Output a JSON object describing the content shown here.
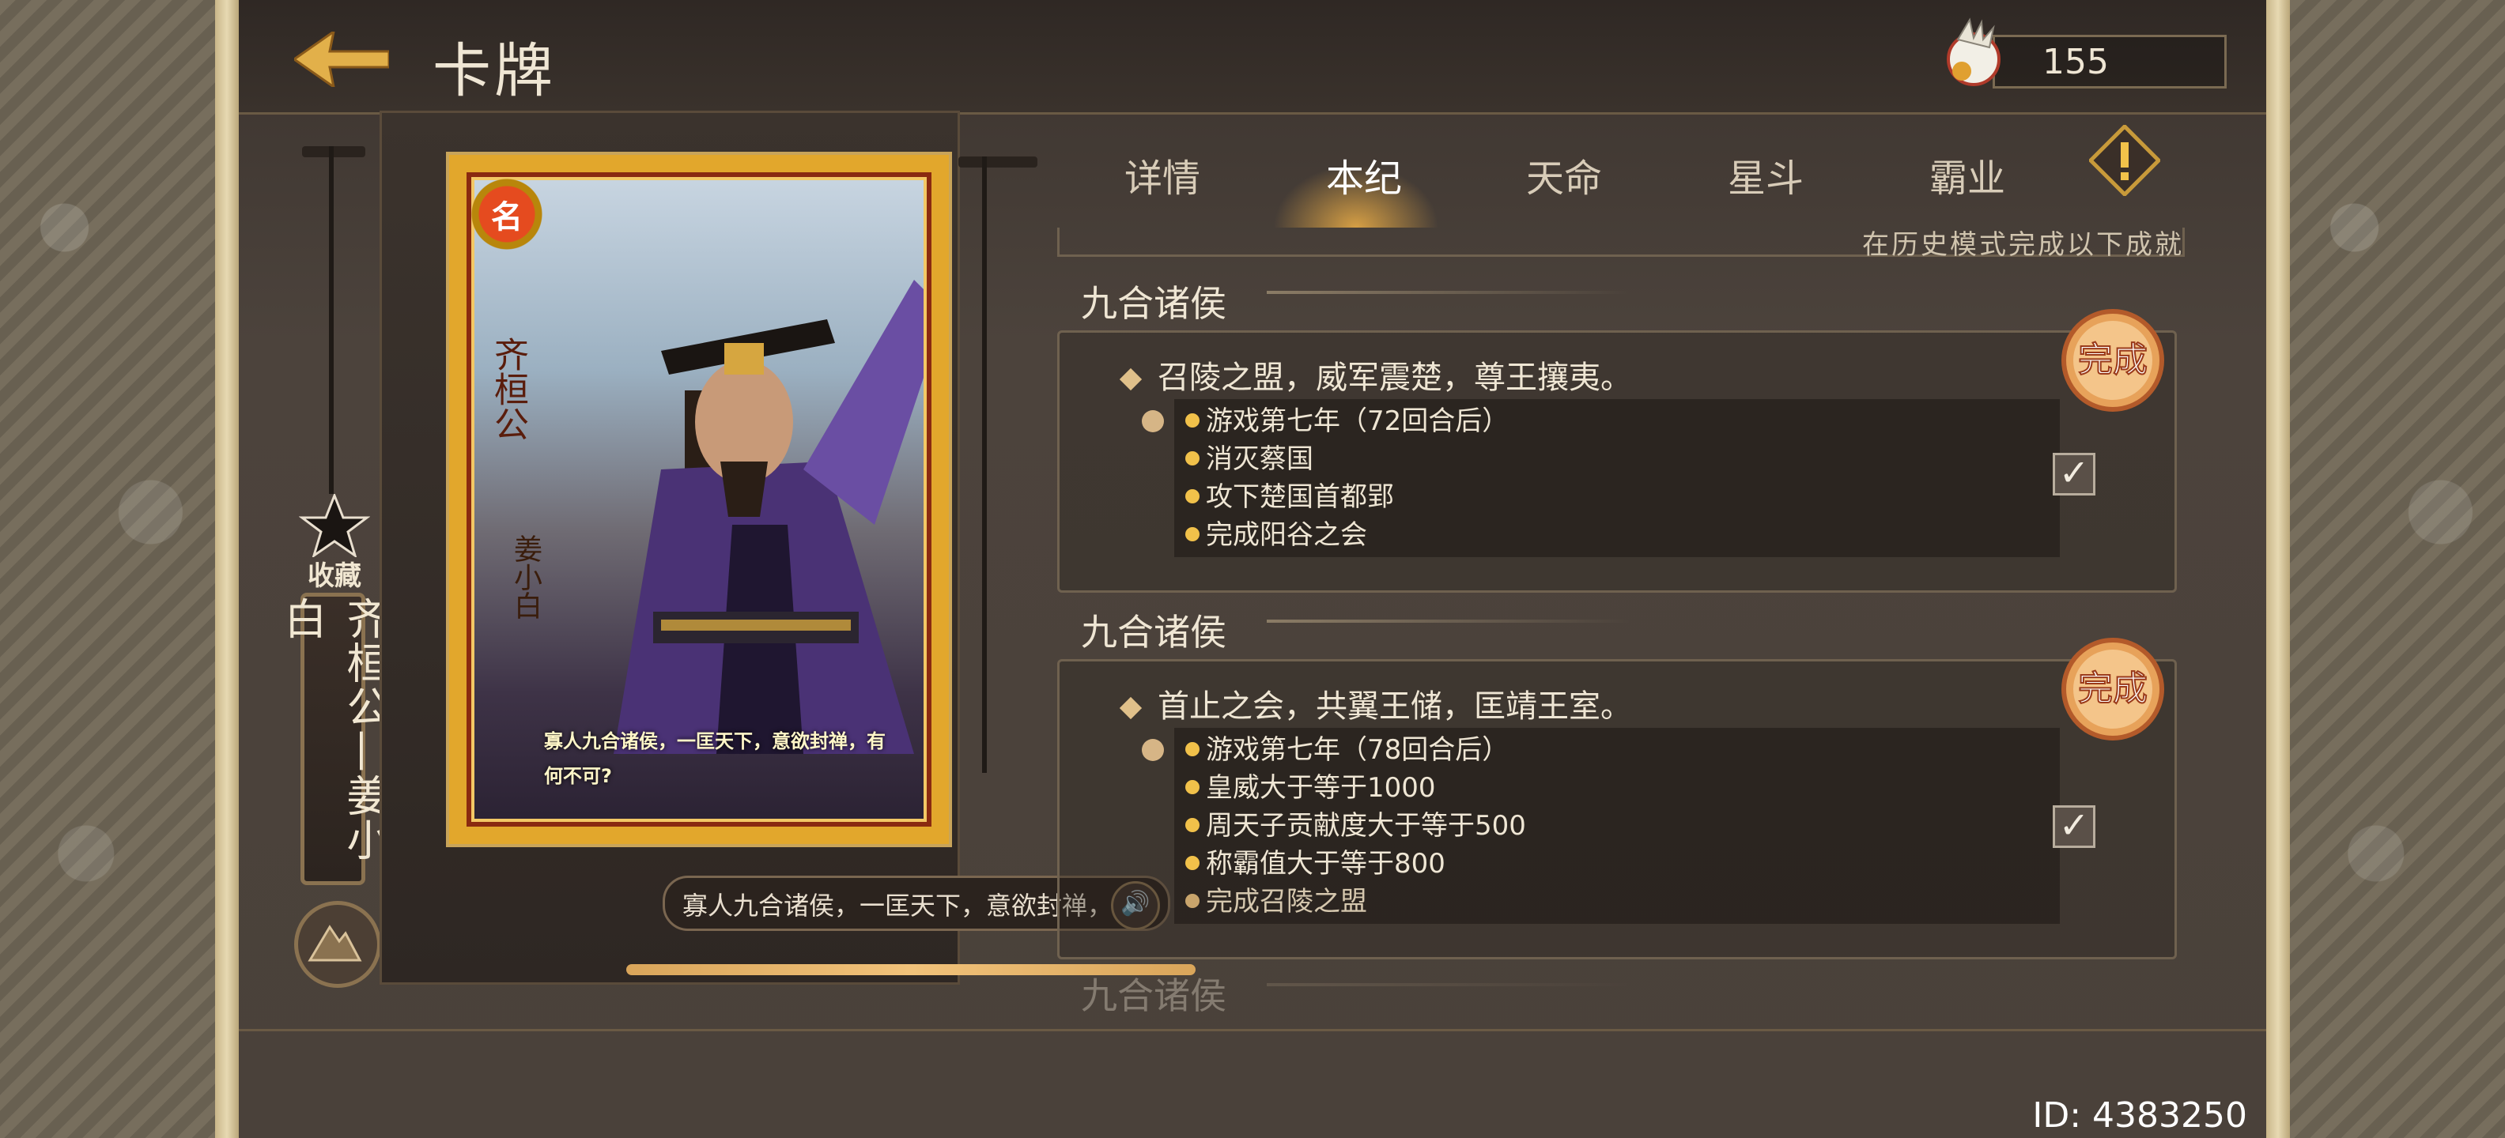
{
  "header": {
    "title": "卡牌",
    "currency_value": "155"
  },
  "card": {
    "seal": "名",
    "vertical_name": "齐桓公",
    "vertical_sub": "姜小白",
    "quote": "寡人九合诸侯，一匡天下，意欲封禅，有何不可?",
    "collect_label": "收藏",
    "name_plate": "齐桓公—姜小白",
    "voice_line": "寡人九合诸侯，一匡天下，意欲封禅，"
  },
  "tabs": [
    {
      "label": "详情",
      "active": false
    },
    {
      "label": "本纪",
      "active": true
    },
    {
      "label": "天命",
      "active": false
    },
    {
      "label": "星斗",
      "active": false
    },
    {
      "label": "霸业",
      "active": false
    }
  ],
  "subheading": "在历史模式完成以下成就",
  "sections": [
    {
      "title": "九合诸侯",
      "achievement": "召陵之盟，威军震楚，尊王攘夷。",
      "conditions": [
        {
          "text": "游戏第七年（72回合后）",
          "done": false
        },
        {
          "text": "消灭蔡国",
          "done": false
        },
        {
          "text": "攻下楚国首都郢",
          "done": false
        },
        {
          "text": "完成阳谷之会",
          "done": false
        }
      ],
      "checked": true,
      "badge": "完成"
    },
    {
      "title": "九合诸侯",
      "achievement": "首止之会，共翼王储，匡靖王室。",
      "conditions": [
        {
          "text": "游戏第七年（78回合后）",
          "done": false
        },
        {
          "text": "皇威大于等于1000",
          "done": false
        },
        {
          "text": "周天子贡献度大于等于500",
          "done": false
        },
        {
          "text": "称霸值大于等于800",
          "done": false
        },
        {
          "text": "完成召陵之盟",
          "done": true
        }
      ],
      "checked": true,
      "badge": "完成"
    },
    {
      "title": "九合诸侯"
    }
  ],
  "footer": {
    "id_label": "ID: 4383250"
  },
  "icons": {
    "back": "arrow-left-icon",
    "currency": "phoenix-coin-icon",
    "alert": "exclamation-diamond-icon",
    "collect": "star-icon",
    "mountain": "mountain-icon",
    "speaker": "speaker-icon",
    "check": "checkmark-icon"
  },
  "colors": {
    "accent_gold": "#e0a030",
    "text": "#efe6d4",
    "panel": "#4a413a"
  }
}
